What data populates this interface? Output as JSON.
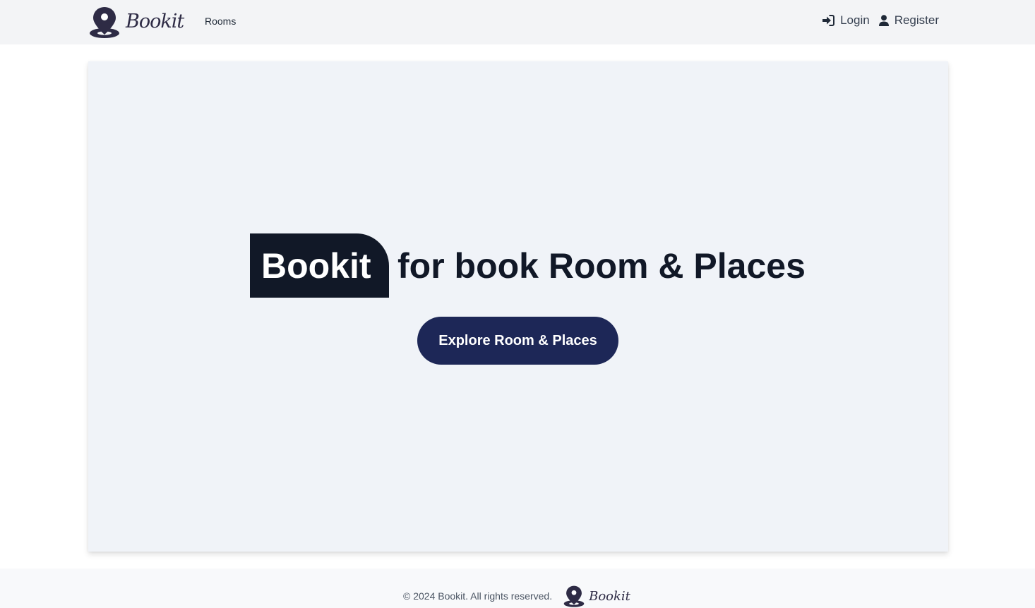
{
  "navbar": {
    "brand": "Bookit",
    "links": [
      {
        "label": "Rooms"
      }
    ],
    "login_label": "Login",
    "register_label": "Register"
  },
  "hero": {
    "brand_highlight": "Bookit",
    "headline_rest": "for book Room & Places",
    "cta_label": "Explore Room & Places"
  },
  "footer": {
    "copyright": "© 2024 Bookit. All rights reserved.",
    "brand": "Bookit"
  },
  "colors": {
    "navbar_bg": "#f3f4f6",
    "hero_bg": "#f0f3f8",
    "dark_text": "#111827",
    "cta_bg": "#1d2757",
    "logo_color": "#2e2b45"
  },
  "icons": {
    "logo": "map-pin-icon",
    "login": "sign-in-icon",
    "register": "user-icon"
  }
}
